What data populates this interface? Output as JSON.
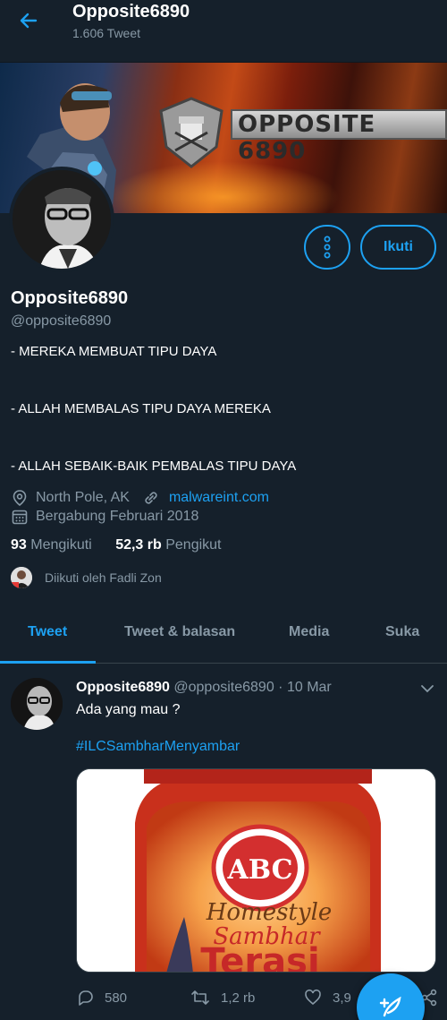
{
  "header": {
    "title": "Opposite6890",
    "tweet_count": "1.606 Tweet"
  },
  "banner": {
    "title_text": "OPPOSITE 6890"
  },
  "profile": {
    "follow_label": "Ikuti",
    "name": "Opposite6890",
    "handle": "@opposite6890",
    "bio": [
      "- MEREKA MEMBUAT TIPU DAYA",
      "- ALLAH MEMBALAS TIPU DAYA MEREKA",
      "- ALLAH SEBAIK-BAIK PEMBALAS TIPU DAYA"
    ],
    "location": "North Pole, AK",
    "website": "malwareint.com",
    "joined": "Bergabung Februari 2018",
    "following_count": "93",
    "following_label": "Mengikuti",
    "followers_count": "52,3 rb",
    "followers_label": "Pengikut",
    "followed_by": "Diikuti oleh Fadli Zon"
  },
  "tabs": [
    "Tweet",
    "Tweet & balasan",
    "Media",
    "Suka"
  ],
  "tweet": {
    "name": "Opposite6890",
    "handle": "@opposite6890",
    "separator": "·",
    "date": "10 Mar",
    "text": "Ada yang mau ?",
    "hashtag": "#ILCSambharMenyambar",
    "image": {
      "brand": "ABC",
      "line1": "Homestyle",
      "line2": "Sambhar",
      "line3": "Terasi"
    },
    "replies": "580",
    "retweets": "1,2 rb",
    "likes": "3,9"
  },
  "colors": {
    "background": "#15202b",
    "accent": "#1da1f2",
    "muted": "#8899a6",
    "divider": "#38444d"
  }
}
